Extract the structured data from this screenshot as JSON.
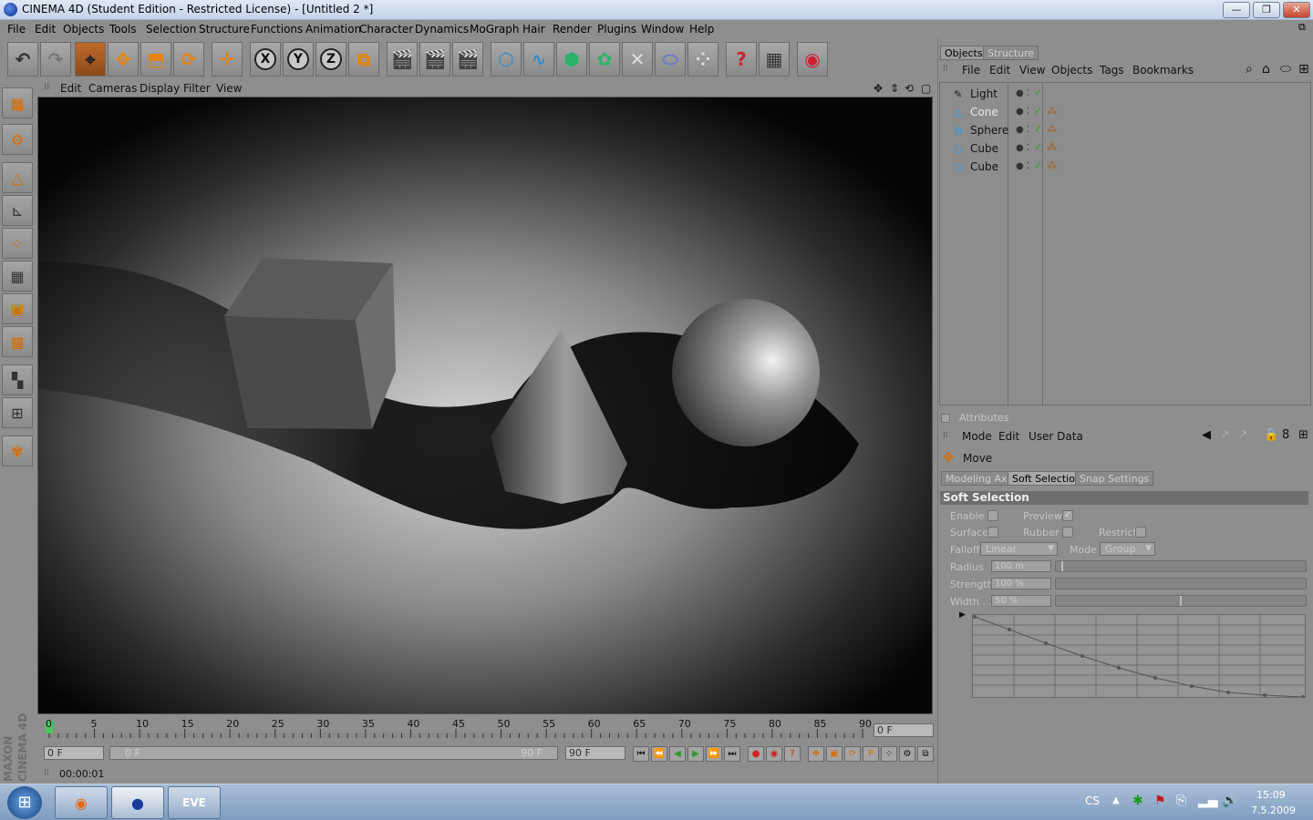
{
  "window": {
    "title": "CINEMA 4D (Student Edition - Restricted License) - [Untitled 2 *]",
    "minimize": "—",
    "maximize": "❐",
    "close": "✕"
  },
  "menu": [
    "File",
    "Edit",
    "Objects",
    "Tools",
    "Selection",
    "Structure",
    "Functions",
    "Animation",
    "Character",
    "Dynamics",
    "MoGraph",
    "Hair",
    "Render",
    "Plugins",
    "Window",
    "Help"
  ],
  "toolbar": {
    "axis_x": "X",
    "axis_y": "Y",
    "axis_z": "Z"
  },
  "viewport": {
    "menu": [
      "Edit",
      "Cameras",
      "Display",
      "Filter",
      "View"
    ]
  },
  "timeline": {
    "ticks": [
      "0",
      "5",
      "10",
      "15",
      "20",
      "25",
      "30",
      "35",
      "40",
      "45",
      "50",
      "55",
      "60",
      "65",
      "70",
      "75",
      "80",
      "85",
      "90"
    ],
    "current_frame_field": "0 F",
    "start_field": "0 F",
    "range_start": "0 F",
    "range_end": "90 F",
    "end_field": "90 F"
  },
  "status": {
    "time": "00:00:01"
  },
  "brand": {
    "line1": "MAXON",
    "line2": "CINEMA 4D"
  },
  "objects_panel": {
    "tabs": [
      "Objects",
      "Structure"
    ],
    "menu": [
      "File",
      "Edit",
      "View",
      "Objects",
      "Tags",
      "Bookmarks"
    ],
    "items": [
      {
        "name": "Light",
        "icon": "light-icon"
      },
      {
        "name": "Cone",
        "icon": "cone-icon"
      },
      {
        "name": "Sphere",
        "icon": "sphere-icon"
      },
      {
        "name": "Cube",
        "icon": "cube-icon"
      },
      {
        "name": "Cube",
        "icon": "cube-icon"
      }
    ]
  },
  "attributes_panel": {
    "title": "Attributes",
    "menu": [
      "Mode",
      "Edit",
      "User Data"
    ],
    "tool": "Move",
    "tabs": [
      "Modeling Axis",
      "Soft Selection",
      "Snap Settings"
    ],
    "section": "Soft Selection",
    "enable": "Enable",
    "preview": "Preview",
    "surface": "Surface",
    "rubber": "Rubber",
    "restrict": "Restrict",
    "falloff_label": "Falloff",
    "falloff_value": "Linear",
    "mode_label": "Mode",
    "mode_value": "Group",
    "radius_label": "Radius",
    "radius_value": "100 m",
    "radius_level": 0.03,
    "strength_label": "Strength",
    "strength_value": "100 %",
    "width_label": "Width . .",
    "width_value": "50 %",
    "width_level": 0.5
  },
  "taskbar": {
    "lang": "CS",
    "time": "15:09",
    "date": "7.5.2009"
  }
}
